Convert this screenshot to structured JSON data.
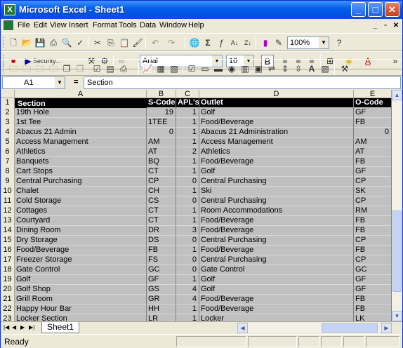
{
  "window": {
    "title": "Microsoft Excel - Sheet1"
  },
  "menu": [
    "File",
    "Edit",
    "View",
    "Insert",
    "Format",
    "Tools",
    "Data",
    "Window",
    "Help"
  ],
  "toolbar1": {
    "zoom": "100%"
  },
  "toolbar2": {
    "security": "Security...",
    "font": "Arial",
    "size": "10"
  },
  "formula_bar": {
    "name_box": "A1",
    "fx": "=",
    "content": "Section"
  },
  "columns": [
    "A",
    "B",
    "C",
    "D",
    "E"
  ],
  "header_row": {
    "num": "1",
    "a": "Section",
    "b": "S-Code",
    "c": "APL's",
    "d": "Outlet",
    "e": "O-Code"
  },
  "rows": [
    {
      "num": "2",
      "a": "19th Hole",
      "b": "19",
      "c": "1",
      "d": "Golf",
      "e": "GF"
    },
    {
      "num": "3",
      "a": "1st Tee",
      "b": "1TEE",
      "c": "1",
      "d": "Food/Beverage",
      "e": "FB"
    },
    {
      "num": "4",
      "a": "Abacus 21 Admin",
      "b": "0",
      "c": "1",
      "d": "Abacus 21 Administration",
      "e": "0"
    },
    {
      "num": "5",
      "a": "Access Management",
      "b": "AM",
      "c": "1",
      "d": "Access Management",
      "e": "AM"
    },
    {
      "num": "6",
      "a": "Athletics",
      "b": "AT",
      "c": "2",
      "d": "Athletics",
      "e": "AT"
    },
    {
      "num": "7",
      "a": "Banquets",
      "b": "BQ",
      "c": "1",
      "d": "Food/Beverage",
      "e": "FB"
    },
    {
      "num": "8",
      "a": "Cart Stops",
      "b": "CT",
      "c": "1",
      "d": "Golf",
      "e": "GF"
    },
    {
      "num": "9",
      "a": "Central Purchasing",
      "b": "CP",
      "c": "0",
      "d": "Central Purchasing",
      "e": "CP"
    },
    {
      "num": "10",
      "a": "Chalet",
      "b": "CH",
      "c": "1",
      "d": "Ski",
      "e": "SK"
    },
    {
      "num": "11",
      "a": "Cold Storage",
      "b": "CS",
      "c": "0",
      "d": "Central Purchasing",
      "e": "CP"
    },
    {
      "num": "12",
      "a": "Cottages",
      "b": "CT",
      "c": "1",
      "d": "Room Accommodations",
      "e": "RM"
    },
    {
      "num": "13",
      "a": "Courtyard",
      "b": "CT",
      "c": "1",
      "d": "Food/Beverage",
      "e": "FB"
    },
    {
      "num": "14",
      "a": "Dining Room",
      "b": "DR",
      "c": "3",
      "d": "Food/Beverage",
      "e": "FB"
    },
    {
      "num": "15",
      "a": "Dry Storage",
      "b": "DS",
      "c": "0",
      "d": "Central Purchasing",
      "e": "CP"
    },
    {
      "num": "16",
      "a": "Food/Beverage",
      "b": "FB",
      "c": "1",
      "d": "Food/Beverage",
      "e": "FB"
    },
    {
      "num": "17",
      "a": "Freezer Storage",
      "b": "FS",
      "c": "0",
      "d": "Central Purchasing",
      "e": "CP"
    },
    {
      "num": "18",
      "a": "Gate Control",
      "b": "GC",
      "c": "0",
      "d": "Gate Control",
      "e": "GC"
    },
    {
      "num": "19",
      "a": "Golf",
      "b": "GF",
      "c": "1",
      "d": "Golf",
      "e": "GF"
    },
    {
      "num": "20",
      "a": "Golf Shop",
      "b": "GS",
      "c": "4",
      "d": "Golf",
      "e": "GF"
    },
    {
      "num": "21",
      "a": "Grill Room",
      "b": "GR",
      "c": "4",
      "d": "Food/Beverage",
      "e": "FB"
    },
    {
      "num": "22",
      "a": "Happy Hour Bar",
      "b": "HH",
      "c": "1",
      "d": "Food/Beverage",
      "e": "FB"
    },
    {
      "num": "23",
      "a": "Locker Section",
      "b": "LR",
      "c": "1",
      "d": "Locker",
      "e": "LK"
    }
  ],
  "sheet_tab": "Sheet1",
  "status": "Ready"
}
